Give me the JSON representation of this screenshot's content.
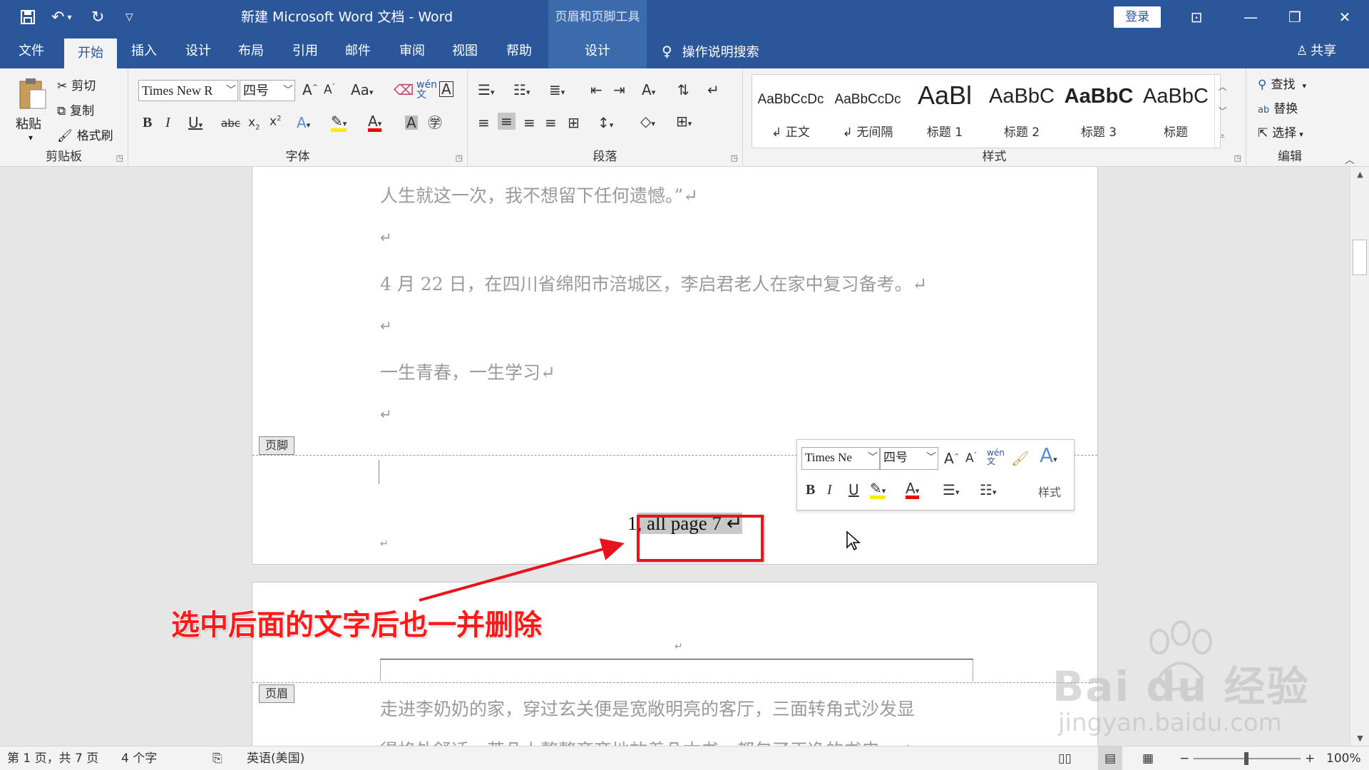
{
  "titlebar": {
    "doc_title": "新建 Microsoft Word 文档  -  Word",
    "context_tool": "页眉和页脚工具",
    "login": "登录"
  },
  "tabs": [
    "文件",
    "开始",
    "插入",
    "设计",
    "布局",
    "引用",
    "邮件",
    "审阅",
    "视图",
    "帮助"
  ],
  "context_tab": "设计",
  "search_hint": "操作说明搜索",
  "share": "共享",
  "ribbon": {
    "clipboard": {
      "paste": "粘贴",
      "cut": "剪切",
      "copy": "复制",
      "format_painter": "格式刷",
      "label": "剪贴板"
    },
    "font": {
      "name": "Times New R",
      "size": "四号",
      "label": "字体"
    },
    "paragraph": {
      "label": "段落"
    },
    "styles": {
      "label": "样式",
      "items": [
        {
          "preview": "AaBbCcDc",
          "name": "↲ 正文"
        },
        {
          "preview": "AaBbCcDc",
          "name": "↲ 无间隔"
        },
        {
          "preview": "AaBl",
          "name": "标题 1"
        },
        {
          "preview": "AaBbC",
          "name": "标题 2"
        },
        {
          "preview": "AaBbC",
          "name": "标题 3"
        },
        {
          "preview": "AaBbC",
          "name": "标题"
        }
      ]
    },
    "editing": {
      "find": "查找",
      "replace": "替换",
      "select": "选择",
      "label": "编辑"
    }
  },
  "document": {
    "paragraphs": [
      "人生就这一次，我不想留下任何遗憾。”↵",
      "↵",
      "4 月 22 日，在四川省绵阳市涪城区，李启君老人在家中复习备考。↵",
      "↵",
      "一生青春，一生学习↵",
      "↵"
    ],
    "footer_tag": "页脚",
    "footer_page_num": "1",
    "footer_selected": ", all page 7  ↵",
    "header_tag": "页眉",
    "next_page_paragraph": "走进李奶奶的家，穿过玄关便是宽敞明亮的客厅，三面转角式沙发显",
    "next_page_paragraph_2": "得格外舒适，茶几上整整齐齐地放着几本书，都包了干净的书皮。↵"
  },
  "minitoolbar": {
    "font": "Times Ne",
    "size": "四号",
    "styles": "样式"
  },
  "statusbar": {
    "page": "第 1 页，共 7 页",
    "words": "4 个字",
    "lang": "英语(美国)",
    "zoom": "100%"
  },
  "annotation": "选中后面的文字后也一并删除",
  "watermark": {
    "brand": "Bai du 经验",
    "url": "jingyan.baidu.com"
  },
  "colors": {
    "brand": "#2b579a",
    "annotation": "#e8131b"
  }
}
